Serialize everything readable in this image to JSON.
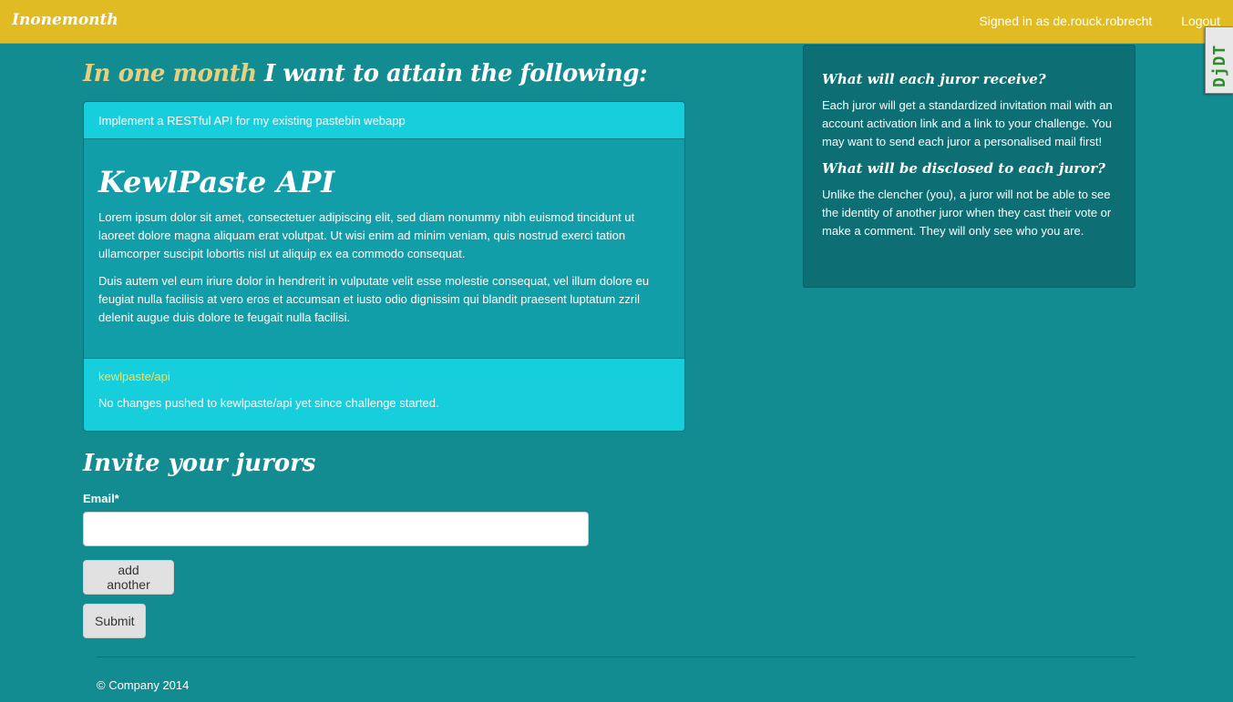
{
  "navbar": {
    "brand": "Inonemonth",
    "signed_in": "Signed in as de.rouck.robrecht",
    "logout": "Logout"
  },
  "debug_toolbar": {
    "label": "DjDT"
  },
  "goal": {
    "heading_accent": "In one month",
    "heading_rest": " I want to attain the following:",
    "summary": "Implement a RESTful API for my existing pastebin webapp",
    "title": "KewlPaste API",
    "paragraphs": [
      "Lorem ipsum dolor sit amet, consectetuer adipiscing elit, sed diam nonummy nibh euismod tincidunt ut laoreet dolore magna aliquam erat volutpat. Ut wisi enim ad minim veniam, quis nostrud exerci tation ullamcorper suscipit lobortis nisl ut aliquip ex ea commodo consequat.",
      "Duis autem vel eum iriure dolor in hendrerit in vulputate velit esse molestie consequat, vel illum dolore eu feugiat nulla facilisis at vero eros et accumsan et iusto odio dignissim qui blandit praesent luptatum zzril delenit augue duis dolore te feugait nulla facilisi."
    ],
    "repo_link": "kewlpaste/api",
    "repo_status": "No changes pushed to kewlpaste/api yet since challenge started."
  },
  "invite": {
    "heading": "Invite your jurors",
    "email_label": "Email*",
    "email_value": "",
    "add_another": "add another",
    "submit": "Submit"
  },
  "sidebar": {
    "q1": "What will each juror receive?",
    "a1": "Each juror will get a standardized invitation mail with an account activation link and a link to your challenge. You may want to send each juror a personalised mail first!",
    "q2": "What will be disclosed to each juror?",
    "a2": "Unlike the clencher (you), a juror will not be able to see the identity of another juror when they cast their vote or make a comment. They will only see who you are."
  },
  "footer": {
    "copyright": "© Company 2014"
  },
  "colors": {
    "navbar": "#e0bb24",
    "background": "#128c91",
    "panel_light": "#16cedc",
    "panel_body": "#129ea8",
    "sidebar": "#0d6e74",
    "accent_text": "#e4d080",
    "link": "#f0e060"
  }
}
